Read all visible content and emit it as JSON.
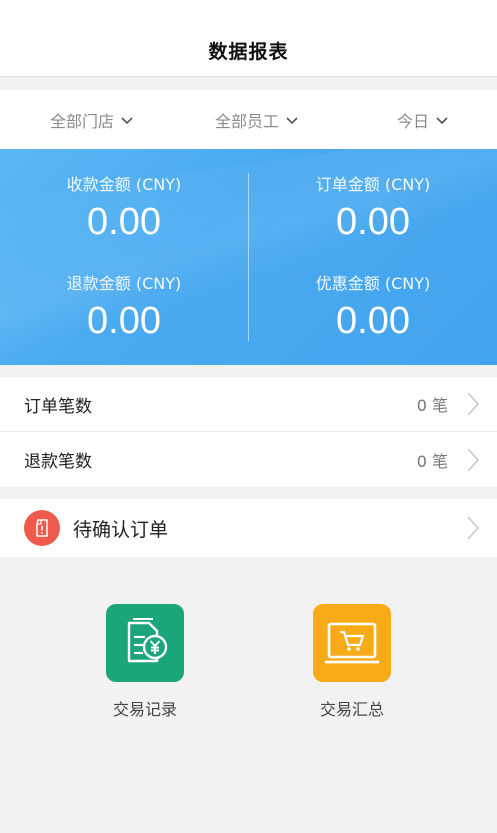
{
  "header": {
    "title": "数据报表"
  },
  "filters": [
    {
      "label": "全部门店"
    },
    {
      "label": "全部员工"
    },
    {
      "label": "今日"
    }
  ],
  "stats": [
    {
      "label": "收款金额 (CNY)",
      "value": "0.00"
    },
    {
      "label": "订单金额 (CNY)",
      "value": "0.00"
    },
    {
      "label": "退款金额 (CNY)",
      "value": "0.00"
    },
    {
      "label": "优惠金额 (CNY)",
      "value": "0.00"
    }
  ],
  "counts": [
    {
      "label": "订单笔数",
      "value": "0 笔"
    },
    {
      "label": "退款笔数",
      "value": "0 笔"
    }
  ],
  "pending": {
    "label": "待确认订单"
  },
  "tiles": [
    {
      "label": "交易记录",
      "icon": "transaction-record-icon"
    },
    {
      "label": "交易汇总",
      "icon": "transaction-summary-icon"
    }
  ],
  "colors": {
    "stats_bg": "#4aaaf0",
    "pending_icon": "#ef5a4c",
    "record_tile": "#1aa57a",
    "summary_tile": "#f8ab16"
  }
}
